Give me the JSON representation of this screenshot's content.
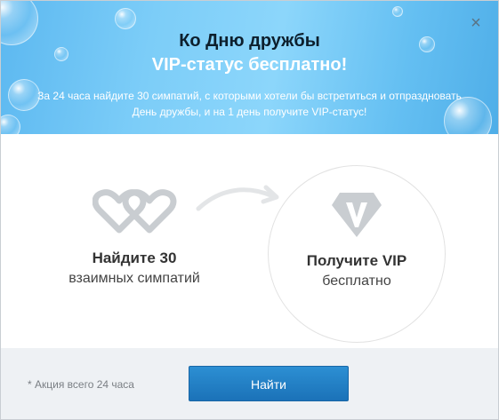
{
  "header": {
    "title_line1": "Ко Дню дружбы",
    "title_line2": "VIP-статус бесплатно!",
    "description": "За 24 часа найдите 30 симпатий, с которыми хотели бы встретиться и отпраздновать День дружбы, и на 1 день получите VIP-статус!",
    "close_icon": "×"
  },
  "steps": [
    {
      "icon": "two-hearts-icon",
      "title": "Найдите 30",
      "subtitle": "взаимных симпатий"
    },
    {
      "icon": "vip-diamond-icon",
      "title": "Получите VIP",
      "subtitle": "бесплатно"
    }
  ],
  "footer": {
    "note": "* Акция всего 24 часа",
    "button_label": "Найти"
  },
  "colors": {
    "header_gradient": "#7ccdf8",
    "button": "#1f7ec6",
    "icon_gray": "#c9cdd1",
    "footer_bg": "#eef1f4"
  }
}
